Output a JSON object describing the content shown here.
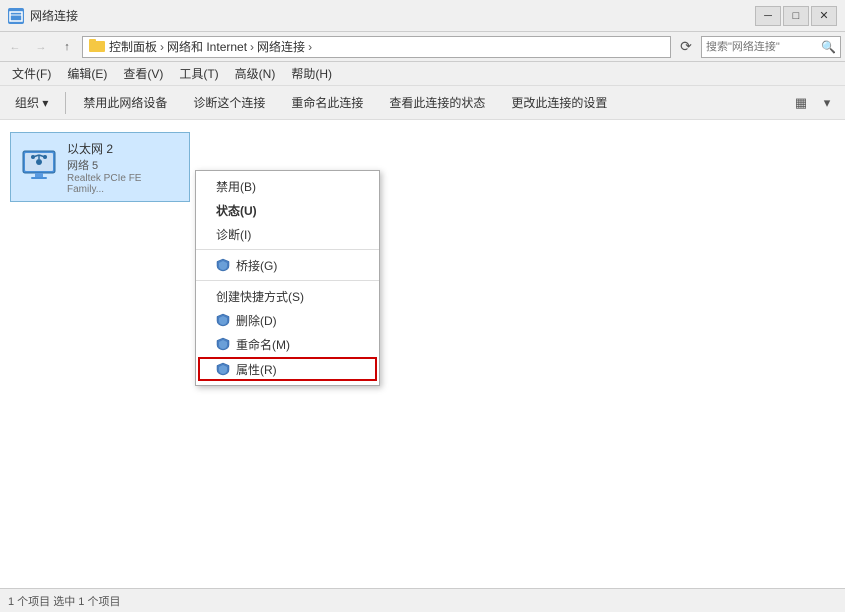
{
  "window": {
    "title": "网络连接",
    "minimize_label": "─",
    "restore_label": "□",
    "close_label": "✕"
  },
  "address_bar": {
    "back_arrow": "←",
    "forward_arrow": "→",
    "up_arrow": "↑",
    "breadcrumb": [
      {
        "label": "控制面板",
        "sep": " › "
      },
      {
        "label": "网络和 Internet",
        "sep": " › "
      },
      {
        "label": "网络连接",
        "sep": " › "
      }
    ],
    "refresh": "⟳",
    "search_placeholder": "搜索\"网络连接\""
  },
  "menu_bar": {
    "items": [
      {
        "label": "文件(F)"
      },
      {
        "label": "编辑(E)"
      },
      {
        "label": "查看(V)"
      },
      {
        "label": "工具(T)"
      },
      {
        "label": "高级(N)"
      },
      {
        "label": "帮助(H)"
      }
    ]
  },
  "toolbar": {
    "organize": "组织 ▾",
    "disable": "禁用此网络设备",
    "diagnose": "诊断这个连接",
    "rename": "重命名此连接",
    "view_status": "查看此连接的状态",
    "change_settings": "更改此连接的设置",
    "view_icon": "▦",
    "dropdown_icon": "▾"
  },
  "network_item": {
    "name": "以太网 2",
    "status": "网络 5",
    "adapter": "Realtek PCIe FE Family..."
  },
  "context_menu": {
    "items": [
      {
        "id": "disable",
        "label": "禁用(B)",
        "has_shield": false,
        "bold": false,
        "separator_after": false
      },
      {
        "id": "status",
        "label": "状态(U)",
        "has_shield": false,
        "bold": true,
        "separator_after": false
      },
      {
        "id": "diagnose",
        "label": "诊断(I)",
        "has_shield": false,
        "bold": false,
        "separator_after": true
      },
      {
        "id": "bridge",
        "label": "桥接(G)",
        "has_shield": true,
        "bold": false,
        "separator_after": false
      },
      {
        "id": "shortcut",
        "label": "创建快捷方式(S)",
        "has_shield": false,
        "bold": false,
        "separator_after": false
      },
      {
        "id": "delete",
        "label": "删除(D)",
        "has_shield": true,
        "bold": false,
        "separator_after": false
      },
      {
        "id": "rename",
        "label": "重命名(M)",
        "has_shield": false,
        "bold": false,
        "separator_after": false
      },
      {
        "id": "properties",
        "label": "属性(R)",
        "has_shield": true,
        "bold": false,
        "highlighted": true,
        "separator_after": false
      }
    ]
  },
  "status_bar": {
    "text": "1 个项目    选中 1 个项目"
  }
}
